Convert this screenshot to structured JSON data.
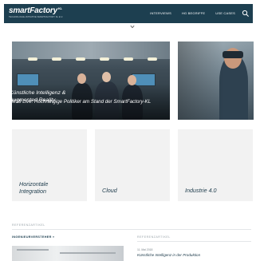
{
  "header": {
    "logo_text": "smartFactory",
    "logo_suffix": "KL",
    "tagline": "TECHNOLOGIE-INITIATIVE SMARTFACTORY KL E.V.",
    "nav": [
      "INTERVIEWS",
      "HG BEGRIFFE",
      "USE CASES"
    ],
    "bg_color": "#1d3f50"
  },
  "hero": {
    "main_title": "HM18 Live: Hochrangige Politiker am Stand der SmartFactory-KL",
    "side_title": "Künstliche Intelligenz & Augmented Reality"
  },
  "tiles": [
    {
      "label": "Horizontale Integration"
    },
    {
      "label": "Cloud"
    },
    {
      "label": "Industrie 4.0"
    }
  ],
  "bottom": {
    "section_label_left": "REFERENZARTIKEL",
    "section_link": "INGENIEURVERSTEHER »",
    "section_label_right": "REFERENZARTIKEL",
    "ref_date": "11. Mai 2018",
    "ref_title": "Künstliche Intelligenz in der Produktion"
  }
}
